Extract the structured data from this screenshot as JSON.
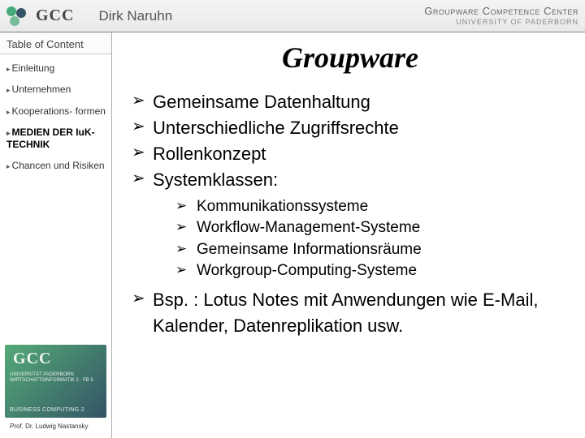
{
  "header": {
    "gcc": "GCC",
    "author": "Dirk Naruhn",
    "center_line1": "Groupware Competence Center",
    "center_line2": "UNIVERSITY OF PADERBORN"
  },
  "sidebar": {
    "toc_title": "Table of Content",
    "items": [
      {
        "label": "Einleitung",
        "active": false
      },
      {
        "label": "Unternehmen",
        "active": false
      },
      {
        "label": "Kooperations-\nformen",
        "active": false
      },
      {
        "label": "MEDIEN DER\nIuK-TECHNIK",
        "active": true
      },
      {
        "label": "Chancen und\nRisiken",
        "active": false
      }
    ],
    "logo_mid": "UNIVERSITÄT PADERBORN\nWIRTSCHAFTSINFORMATIK 2 · FB 5",
    "professor": "Prof. Dr. Ludwig Nastansky"
  },
  "content": {
    "title": "Groupware",
    "bullets_l1": [
      "Gemeinsame Datenhaltung",
      "Unterschiedliche Zugriffsrechte",
      "Rollenkonzept",
      "Systemklassen:"
    ],
    "bullets_l2": [
      "Kommunikationssysteme",
      "Workflow-Management-Systeme",
      "Gemeinsame Informationsräume",
      "Workgroup-Computing-Systeme"
    ],
    "bullets_l1_after": [
      "Bsp. : Lotus Notes mit Anwendungen wie E-Mail, Kalender, Datenreplikation usw."
    ]
  }
}
